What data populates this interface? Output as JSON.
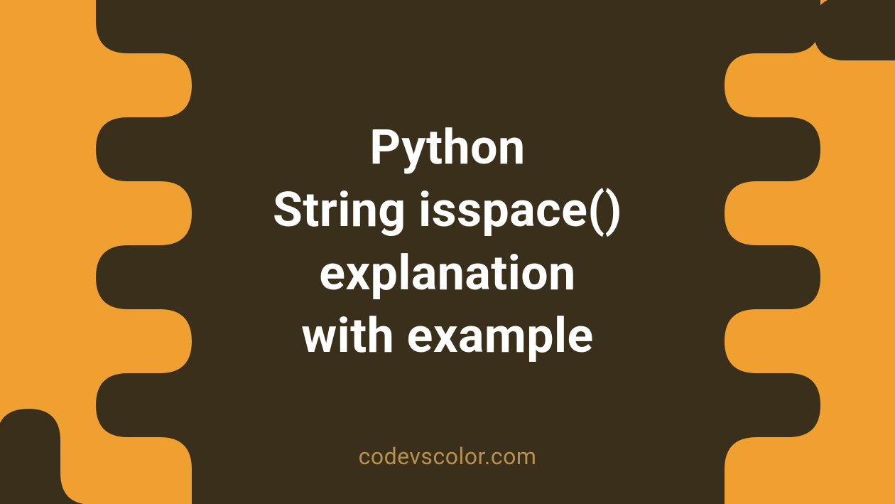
{
  "title_lines": [
    "Python",
    "String isspace()",
    "explanation",
    "with example"
  ],
  "title_full": "Python\nString isspace()\nexplanation\nwith example",
  "watermark": "codevscolor.com",
  "colors": {
    "background": "#f0a030",
    "blob": "#3a2f1a",
    "text": "#ffffff",
    "watermark": "#b89050"
  }
}
